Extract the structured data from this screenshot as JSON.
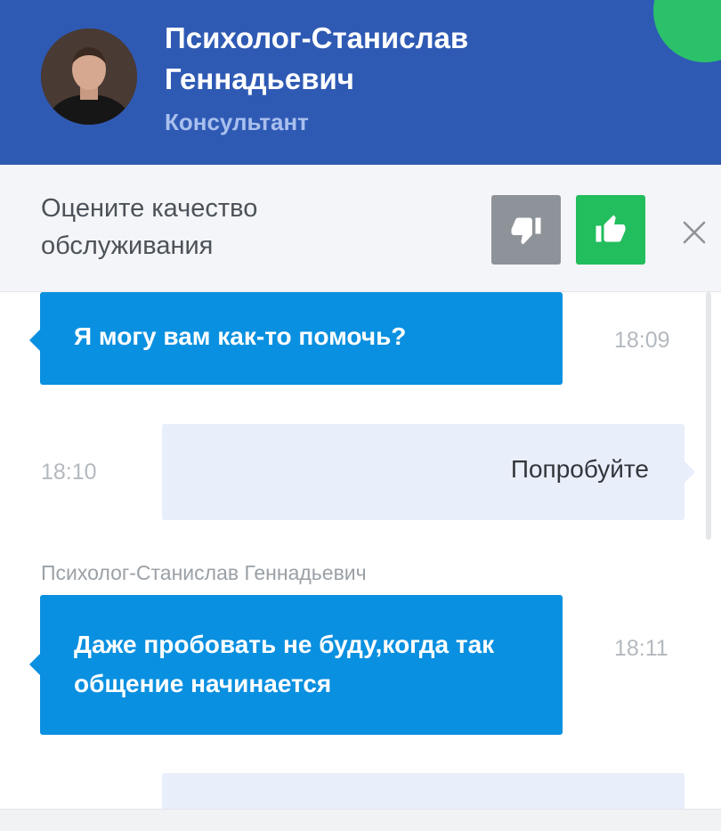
{
  "header": {
    "agent_name": "Психолог-Станислав Геннадьевич",
    "agent_role": "Консультант",
    "accent_color": "#2f5ab4",
    "online_indicator_color": "#2bc06a"
  },
  "rating": {
    "prompt": "Оцените качество обслуживания",
    "dislike_icon": "thumbs-down-icon",
    "like_icon": "thumbs-up-icon",
    "close_icon": "close-icon"
  },
  "messages": [
    {
      "direction": "incoming",
      "text": "Я могу вам как-то помочь?",
      "time": "18:09"
    },
    {
      "direction": "outgoing",
      "text": "Попробуйте",
      "time": "18:10"
    },
    {
      "direction": "incoming",
      "sender": "Психолог-Станислав Геннадьевич",
      "text": "Даже пробовать не буду,когда так общение начинается",
      "time": "18:11"
    }
  ]
}
